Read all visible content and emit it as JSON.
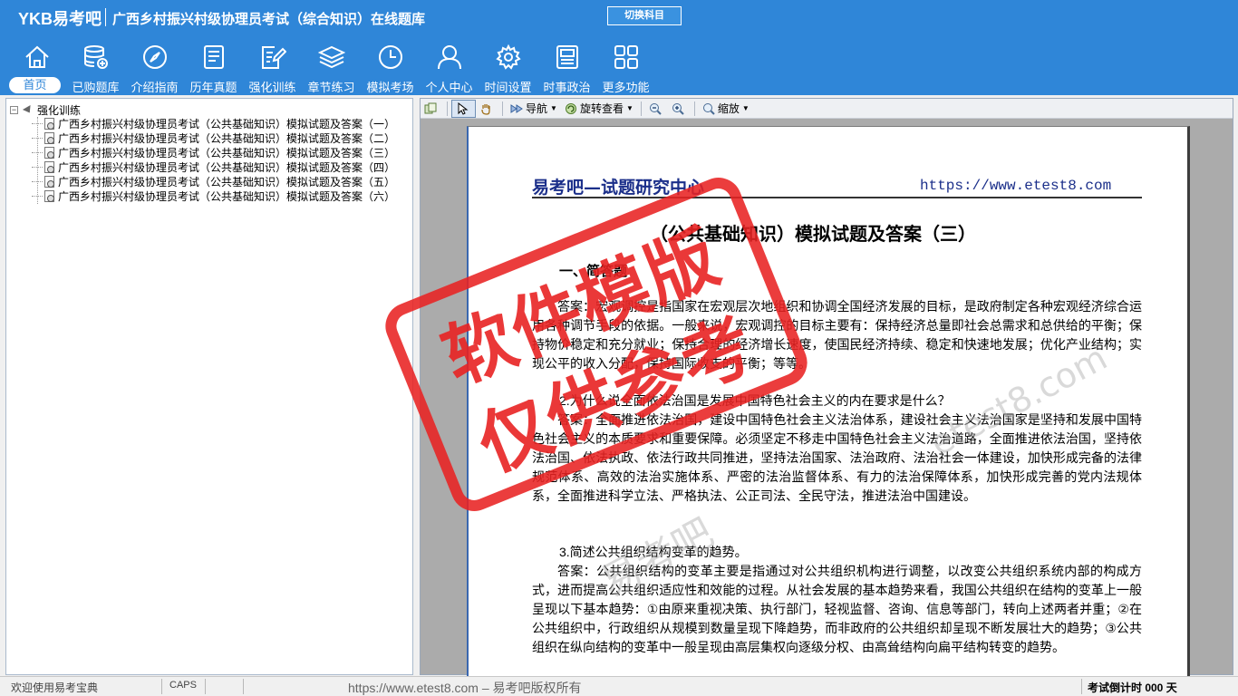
{
  "header": {
    "logo": "YKB易考吧",
    "title": "广西乡村振兴村级协理员考试（综合知识）在线题库",
    "switch_subject": "切换科目"
  },
  "nav": [
    {
      "label": "首页",
      "icon": "home-icon",
      "active": true
    },
    {
      "label": "已购题库",
      "icon": "database-icon"
    },
    {
      "label": "介绍指南",
      "icon": "compass-icon"
    },
    {
      "label": "历年真题",
      "icon": "list-doc-icon"
    },
    {
      "label": "强化训练",
      "icon": "edit-doc-icon"
    },
    {
      "label": "章节练习",
      "icon": "layers-icon"
    },
    {
      "label": "模拟考场",
      "icon": "clock-icon"
    },
    {
      "label": "个人中心",
      "icon": "user-icon"
    },
    {
      "label": "时间设置",
      "icon": "gear-icon"
    },
    {
      "label": "时事政治",
      "icon": "news-icon"
    },
    {
      "label": "更多功能",
      "icon": "grid-icon"
    }
  ],
  "tree": {
    "toggle": "−",
    "root": "强化训练",
    "items": [
      "广西乡村振兴村级协理员考试（公共基础知识）模拟试题及答案（一）",
      "广西乡村振兴村级协理员考试（公共基础知识）模拟试题及答案（二）",
      "广西乡村振兴村级协理员考试（公共基础知识）模拟试题及答案（三）",
      "广西乡村振兴村级协理员考试（公共基础知识）模拟试题及答案（四）",
      "广西乡村振兴村级协理员考试（公共基础知识）模拟试题及答案（五）",
      "广西乡村振兴村级协理员考试（公共基础知识）模拟试题及答案（六）"
    ]
  },
  "toolbar": {
    "navigate": "导航",
    "rotate_view": "旋转查看",
    "zoom": "缩放"
  },
  "document": {
    "header_left": "易考吧—试题研究中心",
    "header_right": "https://www.etest8.com",
    "title": "（公共基础知识）模拟试题及答案（三）",
    "section": "一、简答题",
    "para1": "答案：宏观调控是指国家在宏观层次地组织和协调全国经济发展的目标，是政府制定各种宏观经济综合运用各种调节手段的依据。一般来说，宏观调控的目标主要有：保持经济总量即社会总需求和总供给的平衡；保持物价稳定和充分就业；保持合理的经济增长速度，使国民经济持续、稳定和快速地发展；优化产业结构；实现公平的收入分配，保持国际收支的平衡；等等。",
    "q2": "2.为什么说全面依法治国是发展中国特色社会主义的内在要求是什么？",
    "para2": "答案：全面推进依法治国，建设中国特色社会主义法治体系，建设社会主义法治国家是坚持和发展中国特色社会主义的本质要求和重要保障。必须坚定不移走中国特色社会主义法治道路，全面推进依法治国，坚持依法治国、依法执政、依法行政共同推进，坚持法治国家、法治政府、法治社会一体建设，加快形成完备的法律规范体系、高效的法治实施体系、严密的法治监督体系、有力的法治保障体系，加快形成完善的党内法规体系，全面推进科学立法、严格执法、公正司法、全民守法，推进法治中国建设。",
    "q3": "3.简述公共组织结构变革的趋势。",
    "para3": "答案：公共组织结构的变革主要是指通过对公共组织机构进行调整，以改变公共组织系统内部的构成方式，进而提高公共组织适应性和效能的过程。从社会发展的基本趋势来看，我国公共组织在结构的变革上一般呈现以下基本趋势：①由原来重视决策、执行部门，轻视监督、咨询、信息等部门，转向上述两者并重；②在公共组织中，行政组织从规模到数量呈现下降趋势，而非政府的公共组织却呈现不断发展壮大的趋势；③公共组织在纵向结构的变革中一般呈现由高层集权向逐级分权、由高耸结构向扁平结构转变的趋势。",
    "watermark1": "易考吧",
    "watermark2": "etest8.com"
  },
  "stamp": {
    "line1": "软件模版",
    "line2": "仅供参考"
  },
  "status": {
    "welcome": "欢迎使用易考宝典",
    "caps": "CAPS",
    "center": "https://www.etest8.com – 易考吧版权所有",
    "timer": "考试倒计时 000 天"
  },
  "colors": {
    "header_bg": "#2f86d8",
    "stamp": "#e82222",
    "doc_header": "#1b2f8a"
  }
}
